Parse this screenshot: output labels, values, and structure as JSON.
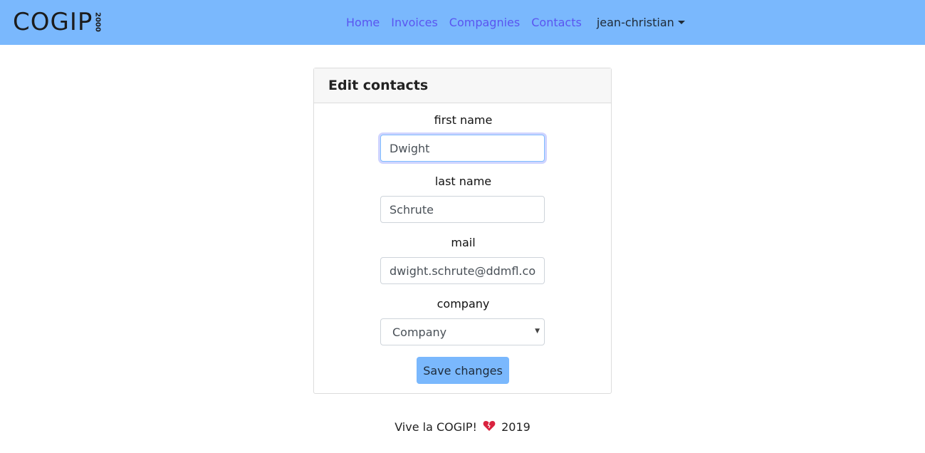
{
  "brand": {
    "name": "COGIP",
    "sub": "2000"
  },
  "nav": {
    "links": [
      {
        "label": "Home"
      },
      {
        "label": "Invoices"
      },
      {
        "label": "Compagnies"
      },
      {
        "label": "Contacts"
      }
    ],
    "user": "jean-christian",
    "link_color": "#5a55f0",
    "bar_color": "#7ab8fd"
  },
  "card": {
    "title": "Edit contacts",
    "fields": {
      "first_name": {
        "label": "first name",
        "value": "Dwight"
      },
      "last_name": {
        "label": "last name",
        "value": "Schrute"
      },
      "mail": {
        "label": "mail",
        "value": "dwight.schrute@ddmfl.com"
      },
      "company": {
        "label": "company",
        "selected": "Company"
      }
    },
    "save_label": "Save changes"
  },
  "footer": {
    "text_before": "Vive la COGIP!",
    "icon": "heart-icon",
    "year": "2019"
  }
}
